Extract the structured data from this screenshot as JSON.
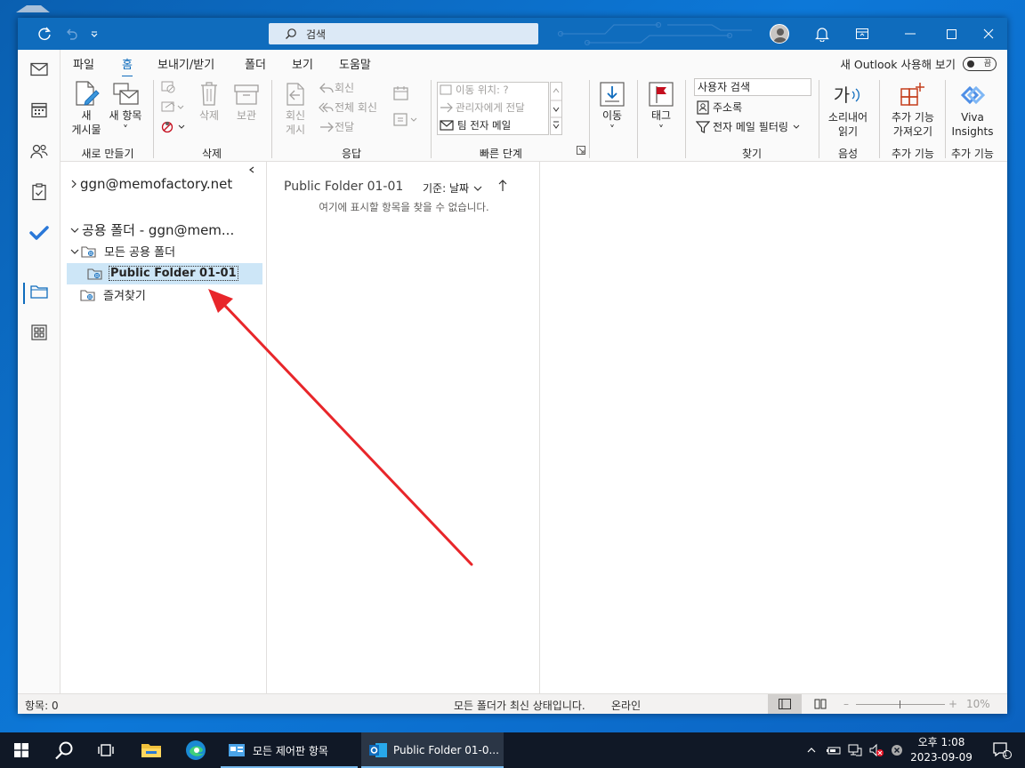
{
  "titlebar": {
    "search_placeholder": "검색"
  },
  "tabs": [
    "파일",
    "홈",
    "보내기/받기",
    "폴더",
    "보기",
    "도움말"
  ],
  "new_outlook": {
    "label": "새 Outlook 사용해 보기",
    "toggle": "끔"
  },
  "ribbon": {
    "new_post_l1": "새",
    "new_post_l2": "게시물",
    "new_items_l1": "새 항목",
    "new_items_l2": "˅",
    "group_new": "새로 만들기",
    "delete": "삭제",
    "archive": "보관",
    "group_delete": "삭제",
    "reply_post_l1": "회신",
    "reply_post_l2": "게시",
    "reply": "회신",
    "reply_all": "전체 회신",
    "forward": "전달",
    "group_respond": "응답",
    "qs_move_to": "이동 위치: ?",
    "qs_to_manager": "관리자에게 전달",
    "qs_team_email": "팀 전자 메일",
    "group_quick_steps": "빠른 단계",
    "move": "이동",
    "move_arrow": "˅",
    "group_move": "",
    "tags": "태그",
    "tags_arrow": "˅",
    "people_search": "사용자 검색",
    "address_book": "주소록",
    "filter_email": "전자 메일 필터링",
    "group_find": "찾기",
    "read_aloud_l1": "소리내어",
    "read_aloud_l2": "읽기",
    "group_speech": "음성",
    "get_addins_l1": "추가 기능",
    "get_addins_l2": "가져오기",
    "group_addins": "추가 기능",
    "viva_l1": "Viva",
    "viva_l2": "Insights",
    "group_addins2": "추가 기능",
    "ga_icon_text": "가"
  },
  "folder_pane": {
    "account": "ggn@memofactory.net",
    "public_root": "공용 폴더 - ggn@mem...",
    "all_public": "모든 공용 폴더",
    "selected_folder": "Public Folder 01-01",
    "favorites": "즐겨찾기"
  },
  "message_list": {
    "folder_title": "Public Folder 01-01",
    "sort_label": "기준: 날짜",
    "empty_text": "여기에 표시할 항목을 찾을 수 없습니다."
  },
  "statusbar": {
    "items_count": "항목: 0",
    "sync_status": "모든 폴더가 최신 상태입니다.",
    "connection": "온라인",
    "zoom": "10%"
  },
  "taskbar": {
    "app1": "모든 제어판 항목",
    "app2": "Public Folder 01-0...",
    "time": "오후 1:08",
    "date": "2023-09-09",
    "notif_count": "1"
  },
  "colors": {
    "accent": "#0f6cbd",
    "selected_bg": "#cde6f7",
    "annotation_arrow": "#e8262a"
  }
}
